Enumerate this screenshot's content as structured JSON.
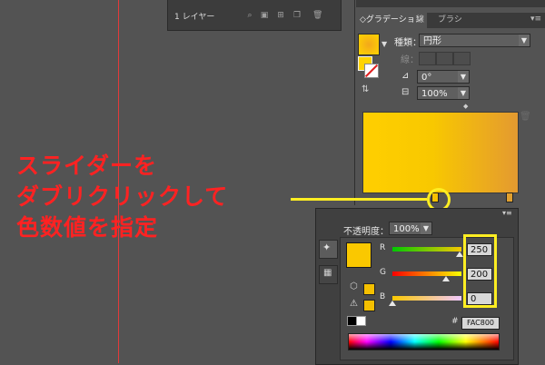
{
  "layers_panel": {
    "label": "1 レイヤー",
    "icons": [
      "search-icon",
      "make-mask-icon",
      "new-sublayer-icon",
      "new-layer-icon",
      "delete-icon"
    ]
  },
  "gradient_panel": {
    "tabs": [
      {
        "label": "◇グラデーション",
        "active": true
      },
      {
        "label": "線",
        "active": false
      },
      {
        "label": "ブラシ",
        "active": false
      }
    ],
    "menu_glyph": "▾≡",
    "type_label": "種類：",
    "type_value": "円形",
    "stroke_label": "線：",
    "angle_value": "0°",
    "aspect_value": "100%",
    "gradient_colors": [
      "#ffcf00",
      "#e49a30"
    ]
  },
  "annotation": {
    "line1": "スライダーを",
    "line2": "ダブリクリックして",
    "line3": "色数値を指定",
    "text_color": "#ff2222",
    "highlight_color": "#ffee22"
  },
  "color_popup": {
    "opacity_label": "不透明度：",
    "opacity_value": "100%",
    "channels": [
      {
        "label": "R",
        "value": "250",
        "fraction": 0.98
      },
      {
        "label": "G",
        "value": "200",
        "fraction": 0.78
      },
      {
        "label": "B",
        "value": "0",
        "fraction": 0.0
      }
    ],
    "hex_label": "#",
    "hex_value": "FAC800",
    "current_color": "#fac800"
  }
}
